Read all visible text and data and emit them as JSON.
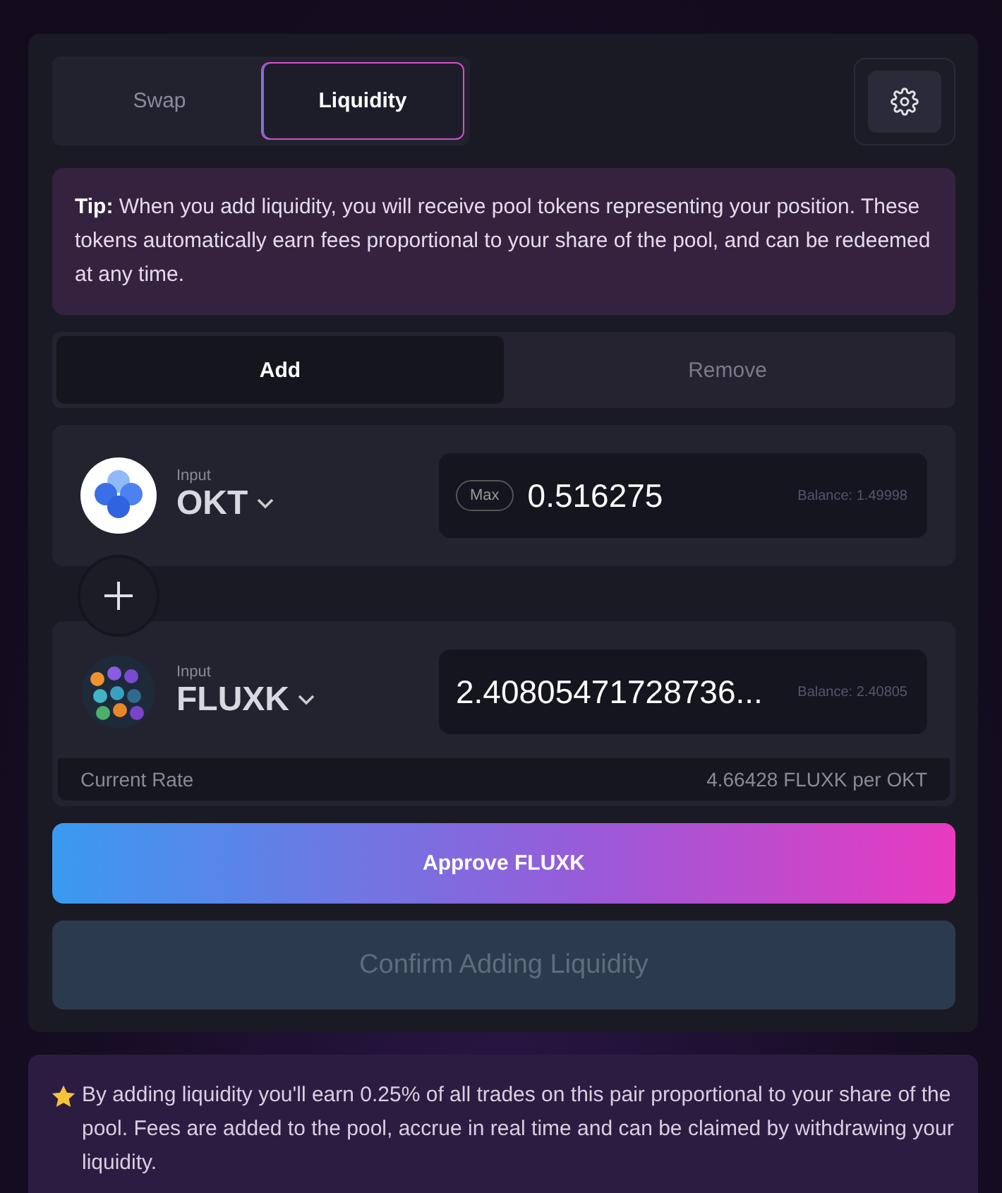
{
  "tabs": [
    {
      "label": "Swap",
      "selected": false
    },
    {
      "label": "Liquidity",
      "selected": true
    }
  ],
  "tip": {
    "label": "Tip:",
    "text": "When you add liquidity, you will receive pool tokens representing your position. These tokens automatically earn fees proportional to your share of the pool, and can be redeemed at any time."
  },
  "mode_tabs": [
    {
      "label": "Add",
      "selected": true
    },
    {
      "label": "Remove",
      "selected": false
    }
  ],
  "tokens": [
    {
      "kind": "okt",
      "caption": "Input",
      "symbol": "OKT",
      "max": "Max",
      "amount": "0.516275",
      "balance": "Balance: 1.49998"
    },
    {
      "kind": "fluxk",
      "caption": "Input",
      "symbol": "FLUXK",
      "amount": "2.40805471728736...",
      "balance": "Balance: 2.40805"
    }
  ],
  "rate": {
    "label": "Current Rate",
    "value": "4.66428 FLUXK per OKT"
  },
  "approve_button": {
    "label": "Approve FLUXK",
    "disabled": false
  },
  "confirm_button": {
    "label": "Confirm Adding Liquidity",
    "disabled": true
  },
  "note": "By adding liquidity you'll earn 0.25% of all trades on this pair proportional to your share of the pool. Fees are added to the pool, accrue in real time and can be claimed by withdrawing your liquidity."
}
